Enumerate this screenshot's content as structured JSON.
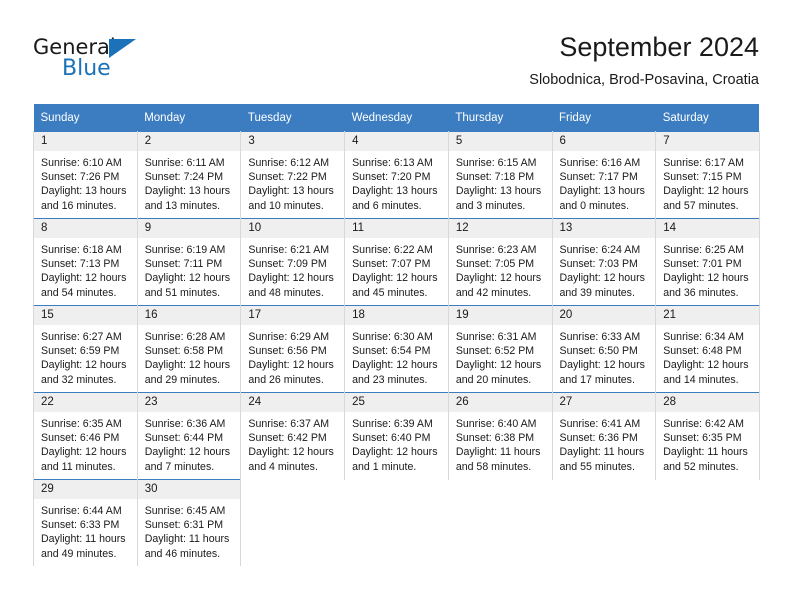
{
  "brand": {
    "name_part1": "General",
    "name_part2": "Blue",
    "triangle_icon": "blue-triangle-icon",
    "accent_color": "#1b72b8"
  },
  "header": {
    "title": "September 2024",
    "subtitle": "Slobodnica, Brod-Posavina, Croatia"
  },
  "calendar": {
    "header_bg": "#3b7dc0",
    "daynum_bg": "#efefef",
    "weekdays": [
      "Sunday",
      "Monday",
      "Tuesday",
      "Wednesday",
      "Thursday",
      "Friday",
      "Saturday"
    ],
    "weeks": [
      [
        {
          "day": "1",
          "sunrise": "Sunrise: 6:10 AM",
          "sunset": "Sunset: 7:26 PM",
          "daylight_line1": "Daylight: 13 hours",
          "daylight_line2": "and 16 minutes."
        },
        {
          "day": "2",
          "sunrise": "Sunrise: 6:11 AM",
          "sunset": "Sunset: 7:24 PM",
          "daylight_line1": "Daylight: 13 hours",
          "daylight_line2": "and 13 minutes."
        },
        {
          "day": "3",
          "sunrise": "Sunrise: 6:12 AM",
          "sunset": "Sunset: 7:22 PM",
          "daylight_line1": "Daylight: 13 hours",
          "daylight_line2": "and 10 minutes."
        },
        {
          "day": "4",
          "sunrise": "Sunrise: 6:13 AM",
          "sunset": "Sunset: 7:20 PM",
          "daylight_line1": "Daylight: 13 hours",
          "daylight_line2": "and 6 minutes."
        },
        {
          "day": "5",
          "sunrise": "Sunrise: 6:15 AM",
          "sunset": "Sunset: 7:18 PM",
          "daylight_line1": "Daylight: 13 hours",
          "daylight_line2": "and 3 minutes."
        },
        {
          "day": "6",
          "sunrise": "Sunrise: 6:16 AM",
          "sunset": "Sunset: 7:17 PM",
          "daylight_line1": "Daylight: 13 hours",
          "daylight_line2": "and 0 minutes."
        },
        {
          "day": "7",
          "sunrise": "Sunrise: 6:17 AM",
          "sunset": "Sunset: 7:15 PM",
          "daylight_line1": "Daylight: 12 hours",
          "daylight_line2": "and 57 minutes."
        }
      ],
      [
        {
          "day": "8",
          "sunrise": "Sunrise: 6:18 AM",
          "sunset": "Sunset: 7:13 PM",
          "daylight_line1": "Daylight: 12 hours",
          "daylight_line2": "and 54 minutes."
        },
        {
          "day": "9",
          "sunrise": "Sunrise: 6:19 AM",
          "sunset": "Sunset: 7:11 PM",
          "daylight_line1": "Daylight: 12 hours",
          "daylight_line2": "and 51 minutes."
        },
        {
          "day": "10",
          "sunrise": "Sunrise: 6:21 AM",
          "sunset": "Sunset: 7:09 PM",
          "daylight_line1": "Daylight: 12 hours",
          "daylight_line2": "and 48 minutes."
        },
        {
          "day": "11",
          "sunrise": "Sunrise: 6:22 AM",
          "sunset": "Sunset: 7:07 PM",
          "daylight_line1": "Daylight: 12 hours",
          "daylight_line2": "and 45 minutes."
        },
        {
          "day": "12",
          "sunrise": "Sunrise: 6:23 AM",
          "sunset": "Sunset: 7:05 PM",
          "daylight_line1": "Daylight: 12 hours",
          "daylight_line2": "and 42 minutes."
        },
        {
          "day": "13",
          "sunrise": "Sunrise: 6:24 AM",
          "sunset": "Sunset: 7:03 PM",
          "daylight_line1": "Daylight: 12 hours",
          "daylight_line2": "and 39 minutes."
        },
        {
          "day": "14",
          "sunrise": "Sunrise: 6:25 AM",
          "sunset": "Sunset: 7:01 PM",
          "daylight_line1": "Daylight: 12 hours",
          "daylight_line2": "and 36 minutes."
        }
      ],
      [
        {
          "day": "15",
          "sunrise": "Sunrise: 6:27 AM",
          "sunset": "Sunset: 6:59 PM",
          "daylight_line1": "Daylight: 12 hours",
          "daylight_line2": "and 32 minutes."
        },
        {
          "day": "16",
          "sunrise": "Sunrise: 6:28 AM",
          "sunset": "Sunset: 6:58 PM",
          "daylight_line1": "Daylight: 12 hours",
          "daylight_line2": "and 29 minutes."
        },
        {
          "day": "17",
          "sunrise": "Sunrise: 6:29 AM",
          "sunset": "Sunset: 6:56 PM",
          "daylight_line1": "Daylight: 12 hours",
          "daylight_line2": "and 26 minutes."
        },
        {
          "day": "18",
          "sunrise": "Sunrise: 6:30 AM",
          "sunset": "Sunset: 6:54 PM",
          "daylight_line1": "Daylight: 12 hours",
          "daylight_line2": "and 23 minutes."
        },
        {
          "day": "19",
          "sunrise": "Sunrise: 6:31 AM",
          "sunset": "Sunset: 6:52 PM",
          "daylight_line1": "Daylight: 12 hours",
          "daylight_line2": "and 20 minutes."
        },
        {
          "day": "20",
          "sunrise": "Sunrise: 6:33 AM",
          "sunset": "Sunset: 6:50 PM",
          "daylight_line1": "Daylight: 12 hours",
          "daylight_line2": "and 17 minutes."
        },
        {
          "day": "21",
          "sunrise": "Sunrise: 6:34 AM",
          "sunset": "Sunset: 6:48 PM",
          "daylight_line1": "Daylight: 12 hours",
          "daylight_line2": "and 14 minutes."
        }
      ],
      [
        {
          "day": "22",
          "sunrise": "Sunrise: 6:35 AM",
          "sunset": "Sunset: 6:46 PM",
          "daylight_line1": "Daylight: 12 hours",
          "daylight_line2": "and 11 minutes."
        },
        {
          "day": "23",
          "sunrise": "Sunrise: 6:36 AM",
          "sunset": "Sunset: 6:44 PM",
          "daylight_line1": "Daylight: 12 hours",
          "daylight_line2": "and 7 minutes."
        },
        {
          "day": "24",
          "sunrise": "Sunrise: 6:37 AM",
          "sunset": "Sunset: 6:42 PM",
          "daylight_line1": "Daylight: 12 hours",
          "daylight_line2": "and 4 minutes."
        },
        {
          "day": "25",
          "sunrise": "Sunrise: 6:39 AM",
          "sunset": "Sunset: 6:40 PM",
          "daylight_line1": "Daylight: 12 hours",
          "daylight_line2": "and 1 minute."
        },
        {
          "day": "26",
          "sunrise": "Sunrise: 6:40 AM",
          "sunset": "Sunset: 6:38 PM",
          "daylight_line1": "Daylight: 11 hours",
          "daylight_line2": "and 58 minutes."
        },
        {
          "day": "27",
          "sunrise": "Sunrise: 6:41 AM",
          "sunset": "Sunset: 6:36 PM",
          "daylight_line1": "Daylight: 11 hours",
          "daylight_line2": "and 55 minutes."
        },
        {
          "day": "28",
          "sunrise": "Sunrise: 6:42 AM",
          "sunset": "Sunset: 6:35 PM",
          "daylight_line1": "Daylight: 11 hours",
          "daylight_line2": "and 52 minutes."
        }
      ],
      [
        {
          "day": "29",
          "sunrise": "Sunrise: 6:44 AM",
          "sunset": "Sunset: 6:33 PM",
          "daylight_line1": "Daylight: 11 hours",
          "daylight_line2": "and 49 minutes."
        },
        {
          "day": "30",
          "sunrise": "Sunrise: 6:45 AM",
          "sunset": "Sunset: 6:31 PM",
          "daylight_line1": "Daylight: 11 hours",
          "daylight_line2": "and 46 minutes."
        },
        {
          "day": "",
          "sunrise": "",
          "sunset": "",
          "daylight_line1": "",
          "daylight_line2": ""
        },
        {
          "day": "",
          "sunrise": "",
          "sunset": "",
          "daylight_line1": "",
          "daylight_line2": ""
        },
        {
          "day": "",
          "sunrise": "",
          "sunset": "",
          "daylight_line1": "",
          "daylight_line2": ""
        },
        {
          "day": "",
          "sunrise": "",
          "sunset": "",
          "daylight_line1": "",
          "daylight_line2": ""
        },
        {
          "day": "",
          "sunrise": "",
          "sunset": "",
          "daylight_line1": "",
          "daylight_line2": ""
        }
      ]
    ]
  }
}
